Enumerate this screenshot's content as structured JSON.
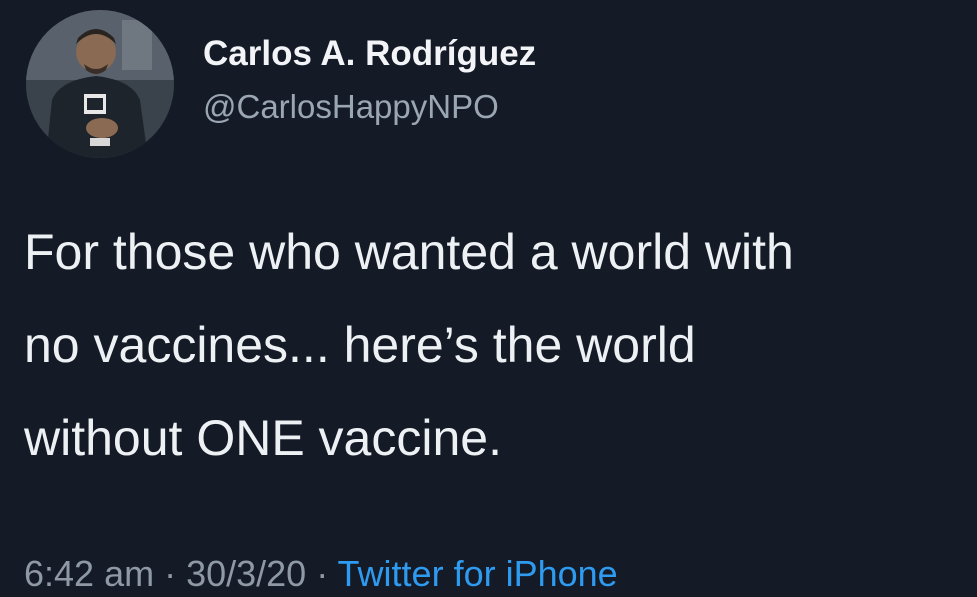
{
  "author": {
    "display_name": "Carlos A. Rodríguez",
    "handle": "@CarlosHappyNPO"
  },
  "tweet": {
    "lines": [
      "For those who wanted a world with",
      "no vaccines... here’s the world",
      "without ONE vaccine."
    ]
  },
  "meta": {
    "time": "6:42 am",
    "separator1": " · ",
    "date": "30/3/20",
    "separator2": " · ",
    "source": "Twitter for iPhone"
  },
  "colors": {
    "background": "#141b27",
    "text": "#eef1f4",
    "muted": "#8e99a5",
    "link": "#2f9bf0"
  }
}
